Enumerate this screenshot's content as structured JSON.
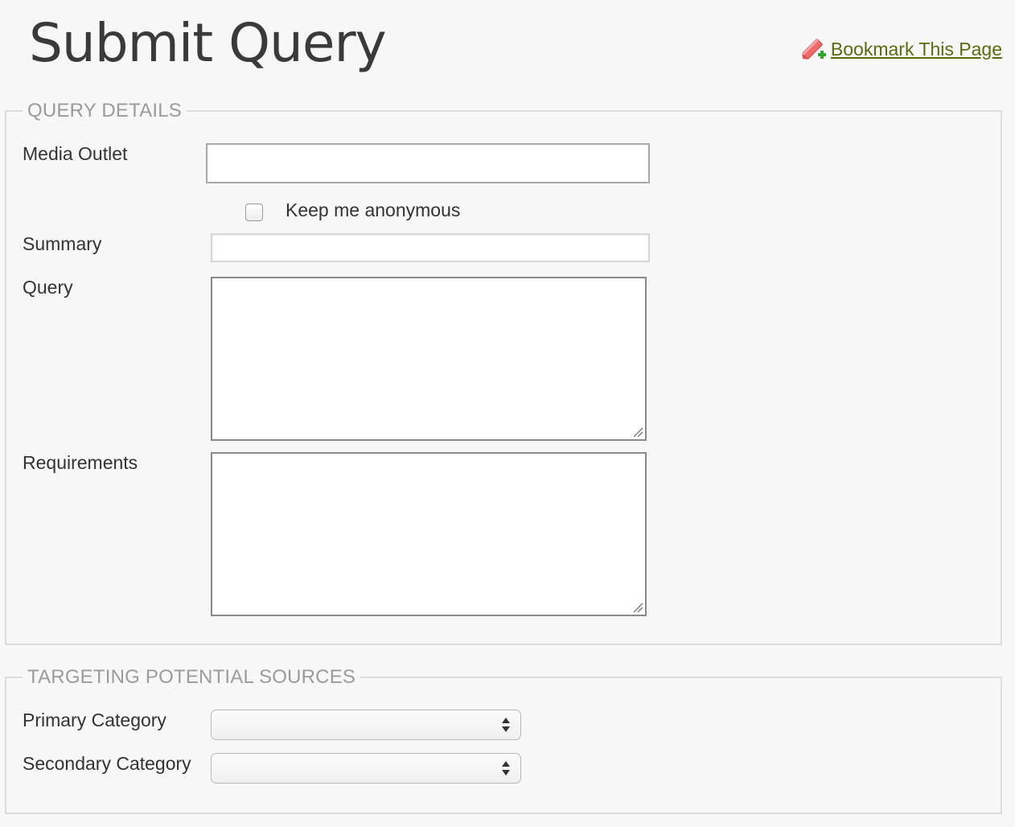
{
  "header": {
    "title": "Submit Query",
    "bookmark_label": "Bookmark This Page",
    "bookmark_icon": "bookmark-add-icon"
  },
  "query_details": {
    "legend": "QUERY DETAILS",
    "media_outlet": {
      "label": "Media Outlet",
      "value": ""
    },
    "anonymous": {
      "label": "Keep me anonymous",
      "checked": false
    },
    "summary": {
      "label": "Summary",
      "value": ""
    },
    "query": {
      "label": "Query",
      "value": ""
    },
    "requirements": {
      "label": "Requirements",
      "value": ""
    }
  },
  "targeting": {
    "legend": "TARGETING POTENTIAL SOURCES",
    "primary_category": {
      "label": "Primary Category",
      "selected": ""
    },
    "secondary_category": {
      "label": "Secondary Category",
      "selected": ""
    }
  },
  "colors": {
    "background": "#f7f7f7",
    "link": "#5a6b12",
    "legend": "#9b9b9b",
    "title": "#3a3a3a"
  }
}
